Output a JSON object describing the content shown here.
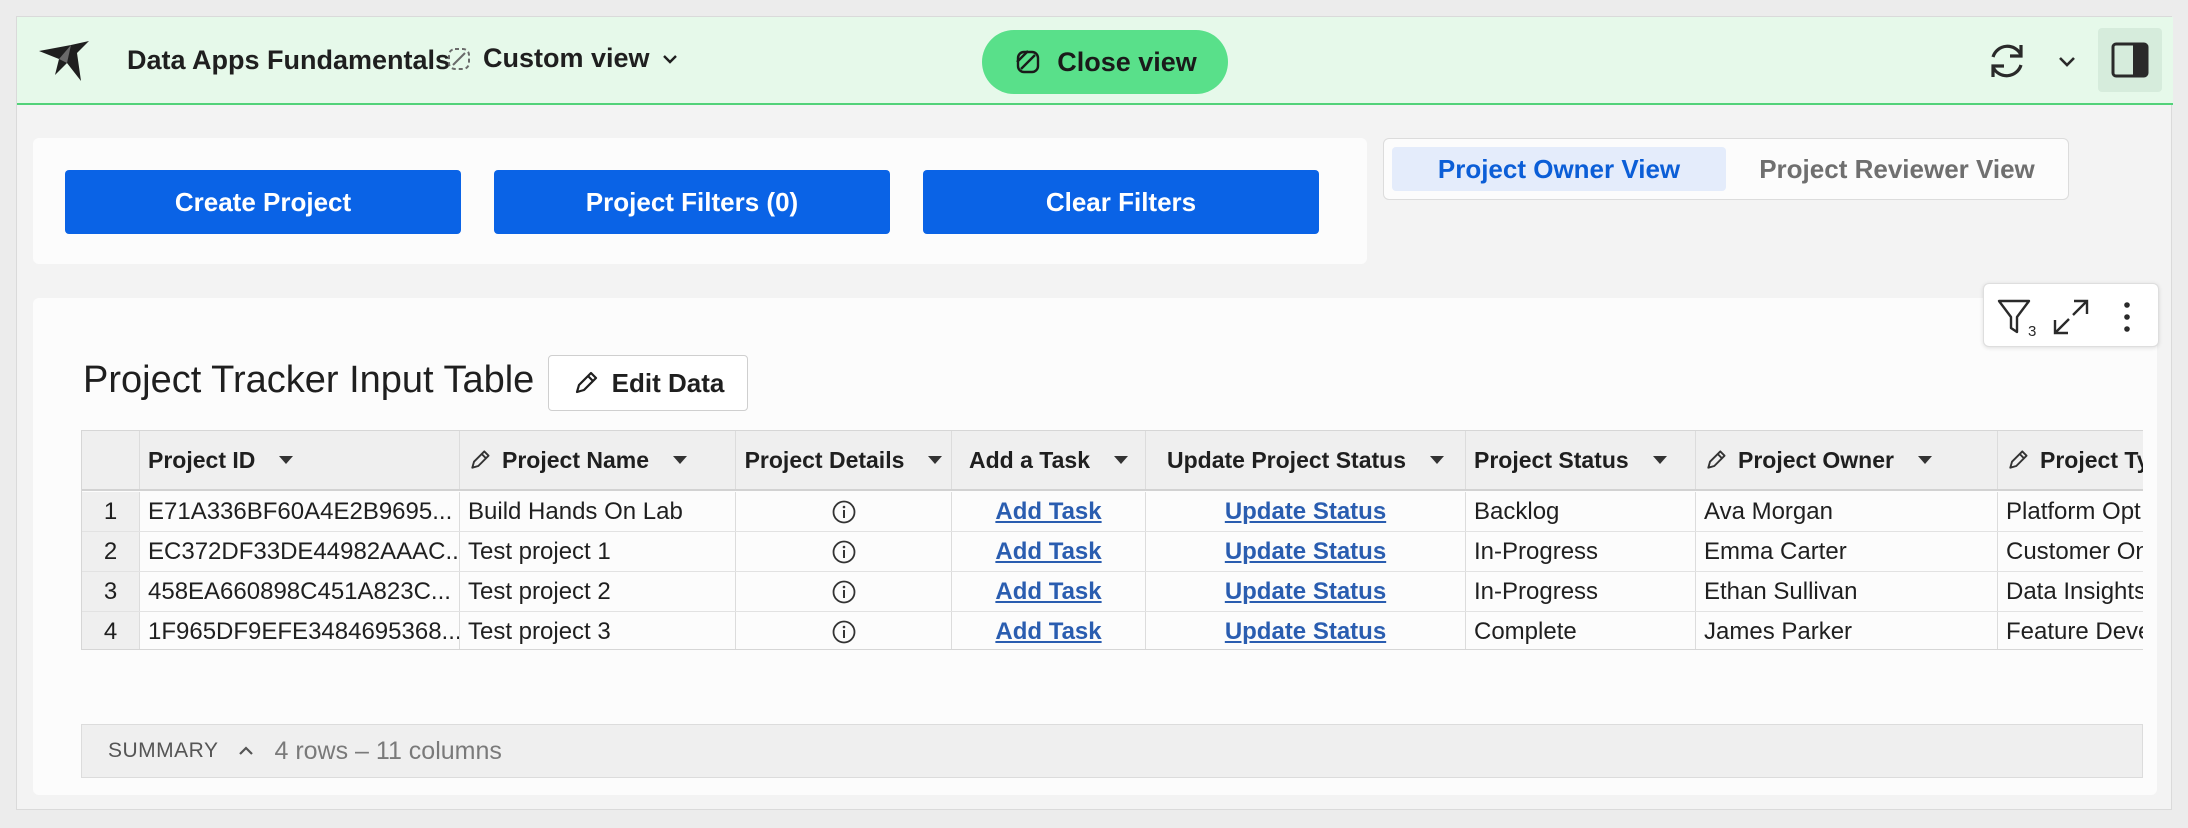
{
  "header": {
    "app_title": "Data Apps Fundamentals",
    "view_label": "Custom view",
    "close_view_label": "Close view",
    "brand_color": "#59e08a",
    "bar_color": "#e6f9ea"
  },
  "controls": {
    "create_project": "Create Project",
    "project_filters": "Project Filters (0)",
    "clear_filters": "Clear Filters",
    "button_color": "#0a63e6"
  },
  "views": {
    "owner": "Project Owner View",
    "reviewer": "Project Reviewer View",
    "active": "owner"
  },
  "table": {
    "title": "Project Tracker Input Table",
    "edit_label": "Edit Data",
    "filter_count": "3",
    "columns": [
      {
        "label": "Project ID",
        "editable": false
      },
      {
        "label": "Project Name",
        "editable": true
      },
      {
        "label": "Project Details",
        "editable": false
      },
      {
        "label": "Add a Task",
        "editable": false
      },
      {
        "label": "Update Project Status",
        "editable": false
      },
      {
        "label": "Project Status",
        "editable": false
      },
      {
        "label": "Project Owner",
        "editable": true
      },
      {
        "label": "Project Ty",
        "editable": true
      }
    ],
    "rows": [
      {
        "num": "1",
        "id": "E71A336BF60A4E2B9695...",
        "name": "Build Hands On Lab",
        "details_icon": "info-icon",
        "task": "Add Task",
        "update": "Update Status",
        "status": "Backlog",
        "owner": "Ava Morgan",
        "type": "Platform Opt"
      },
      {
        "num": "2",
        "id": "EC372DF33DE44982AAAC...",
        "name": "Test project 1",
        "details_icon": "info-icon",
        "task": "Add Task",
        "update": "Update Status",
        "status": "In-Progress",
        "owner": "Emma Carter",
        "type": "Customer On"
      },
      {
        "num": "3",
        "id": "458EA660898C451A823C...",
        "name": "Test project 2",
        "details_icon": "info-icon",
        "task": "Add Task",
        "update": "Update Status",
        "status": "In-Progress",
        "owner": "Ethan Sullivan",
        "type": "Data Insights"
      },
      {
        "num": "4",
        "id": "1F965DF9EFE3484695368...",
        "name": "Test project 3",
        "details_icon": "info-icon",
        "task": "Add Task",
        "update": "Update Status",
        "status": "Complete",
        "owner": "James Parker",
        "type": "Feature Deve"
      }
    ]
  },
  "summary": {
    "label": "SUMMARY",
    "info": "4 rows – 11 columns"
  }
}
